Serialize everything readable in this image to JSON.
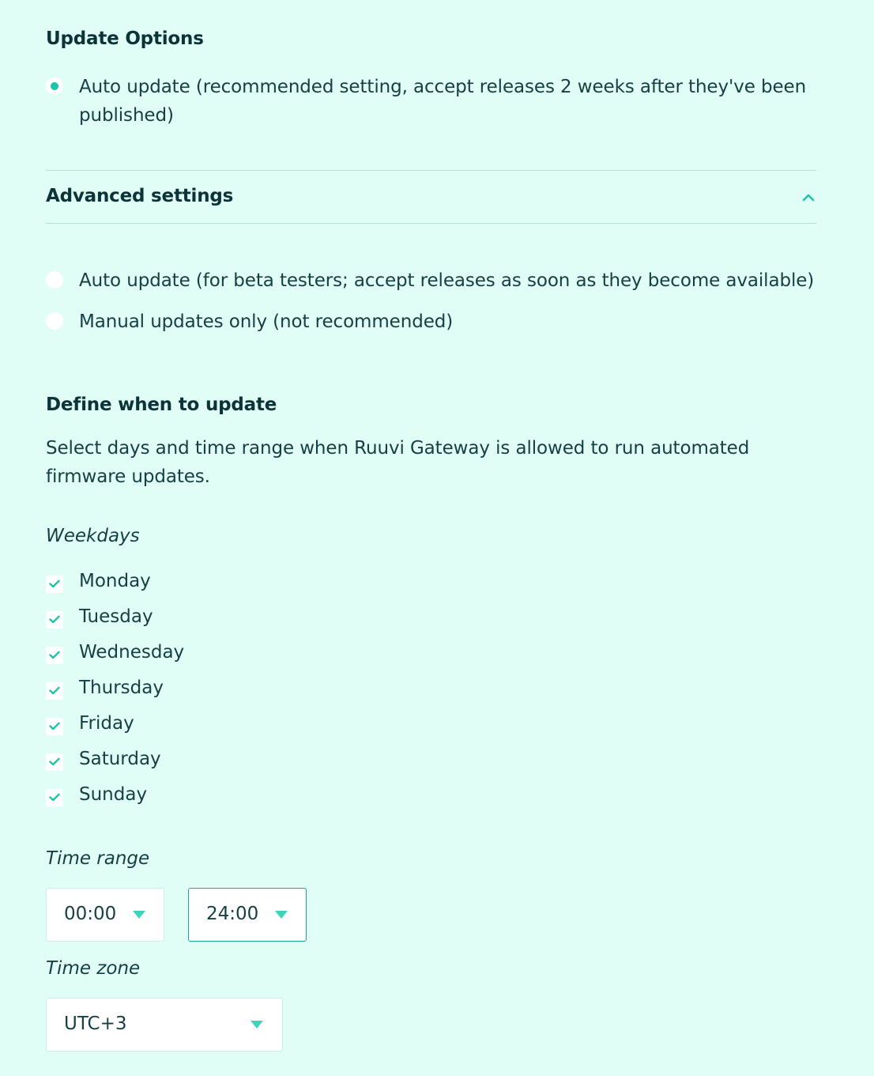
{
  "update_options": {
    "title": "Update Options",
    "recommended_label": "Auto update (recommended setting, accept releases 2 weeks after they've been published)",
    "recommended_checked": true
  },
  "advanced": {
    "title": "Advanced settings",
    "expanded": true,
    "beta_label": "Auto update (for beta testers; accept releases as soon as they become available)",
    "manual_label": "Manual updates only (not recommended)"
  },
  "schedule": {
    "title": "Define when to update",
    "description": "Select days and time range when Ruuvi Gateway is allowed to run automated firmware updates.",
    "weekdays_label": "Weekdays",
    "days": [
      {
        "label": "Monday",
        "checked": true
      },
      {
        "label": "Tuesday",
        "checked": true
      },
      {
        "label": "Wednesday",
        "checked": true
      },
      {
        "label": "Thursday",
        "checked": true
      },
      {
        "label": "Friday",
        "checked": true
      },
      {
        "label": "Saturday",
        "checked": true
      },
      {
        "label": "Sunday",
        "checked": true
      }
    ],
    "time_range_label": "Time range",
    "time_from": "00:00",
    "time_to": "24:00",
    "time_zone_label": "Time zone",
    "time_zone": "UTC+3"
  },
  "colors": {
    "background": "#e0fdf6",
    "accent": "#19c4a8",
    "text": "#163f44"
  }
}
